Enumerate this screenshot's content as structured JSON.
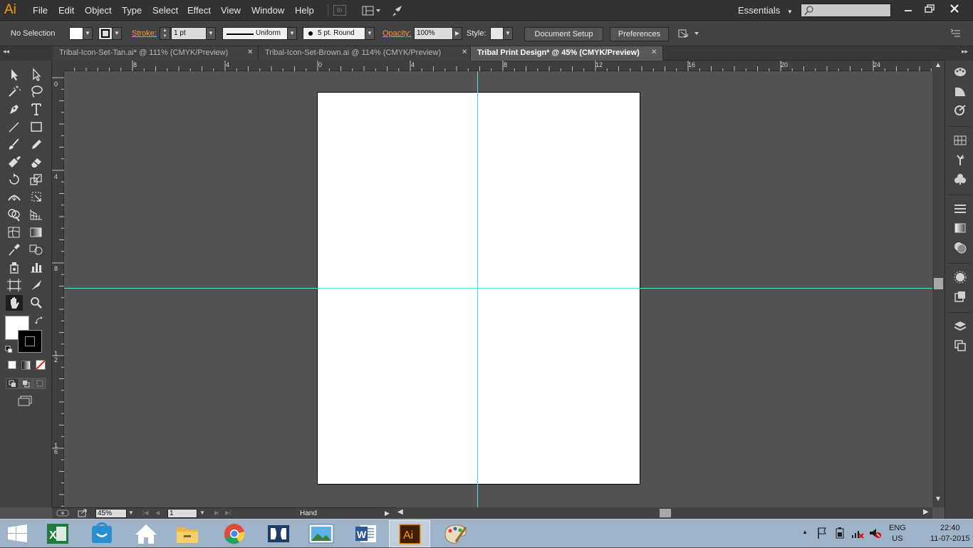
{
  "app": {
    "logo": "Ai"
  },
  "menu": [
    "File",
    "Edit",
    "Object",
    "Type",
    "Select",
    "Effect",
    "View",
    "Window",
    "Help"
  ],
  "header": {
    "bridge_label": "Br",
    "workspace": "Essentials",
    "search_placeholder": ""
  },
  "control": {
    "selection": "No Selection",
    "stroke_label": "Stroke:",
    "stroke_weight": "1 pt",
    "profile": "Uniform",
    "brush": "5 pt. Round",
    "opacity_label": "Opacity:",
    "opacity": "100%",
    "style_label": "Style:",
    "doc_setup": "Document Setup",
    "preferences": "Preferences"
  },
  "tabs": [
    {
      "label": "Tribal-Icon-Set-Tan.ai* @ 111% (CMYK/Preview)",
      "active": false
    },
    {
      "label": "Tribal-Icon-Set-Brown.ai @ 114% (CMYK/Preview)",
      "active": false
    },
    {
      "label": "Tribal Print Design* @ 45% (CMYK/Preview)",
      "active": true
    }
  ],
  "rulers": {
    "horizontal": [
      "8",
      "4",
      "0",
      "4",
      "8",
      "12",
      "16",
      "20",
      "24"
    ],
    "vertical": [
      "0",
      "4",
      "8",
      "1\n2",
      "1\n6"
    ]
  },
  "status": {
    "zoom": "45%",
    "artboard": "1",
    "tool": "Hand"
  },
  "taskbar": {
    "lang": "ENG",
    "region": "US",
    "time": "22:40",
    "date": "11-07-2015"
  },
  "colors": {
    "accent": "#ff9a00",
    "guide": "#4fe0e0",
    "artboard": "#ffffff"
  }
}
